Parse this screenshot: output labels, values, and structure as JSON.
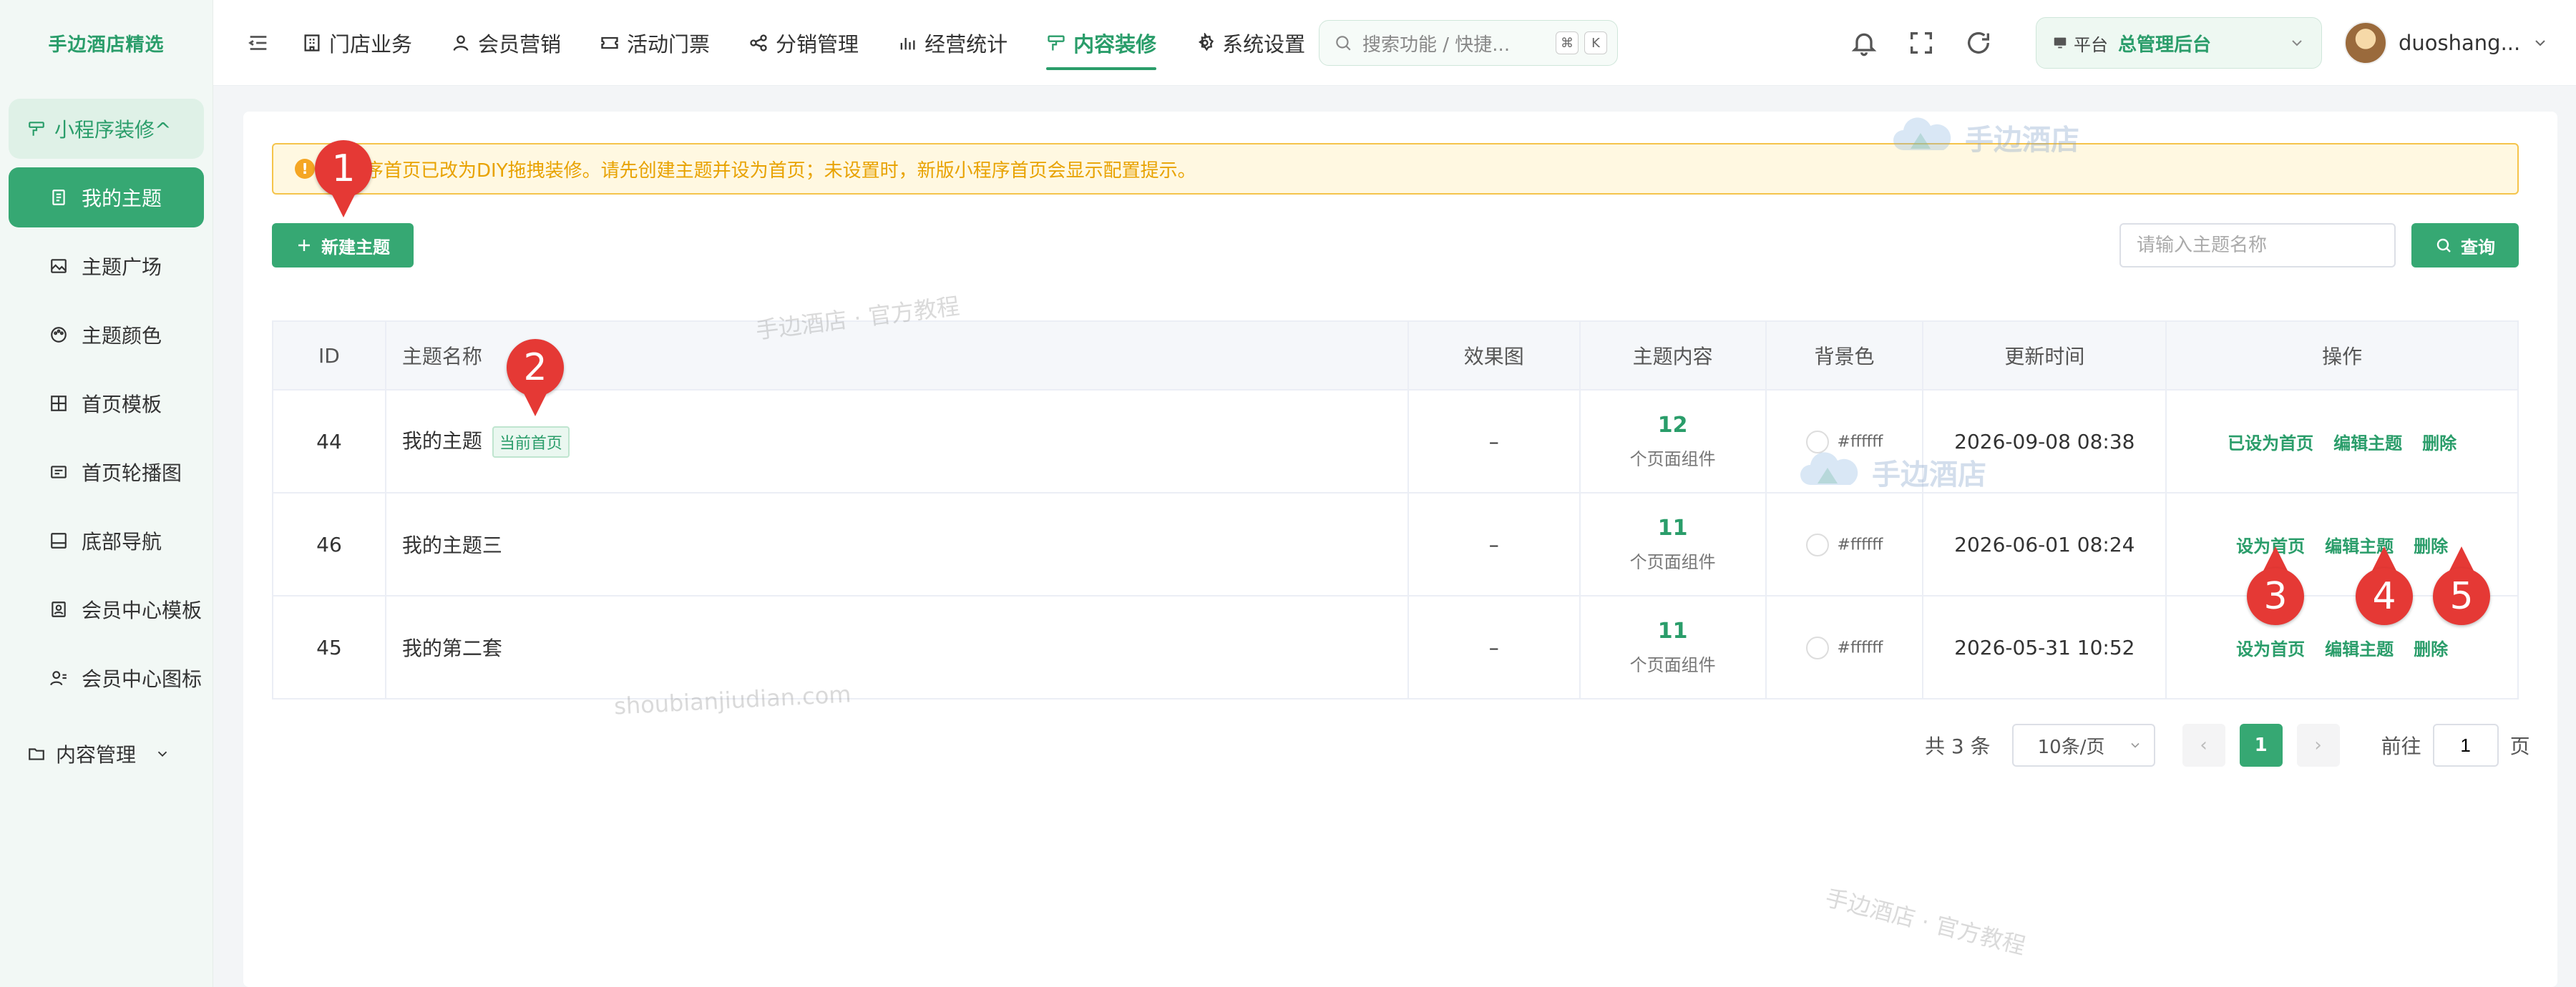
{
  "brand": "手边酒店精选",
  "sidebar": {
    "group_label": "小程序装修^",
    "items": [
      {
        "label": "我的主题",
        "icon": "document-icon",
        "active": true
      },
      {
        "label": "主题广场",
        "icon": "gallery-icon"
      },
      {
        "label": "主题颜色",
        "icon": "palette-icon"
      },
      {
        "label": "首页模板",
        "icon": "grid-icon"
      },
      {
        "label": "首页轮播图",
        "icon": "carousel-icon"
      },
      {
        "label": "底部导航",
        "icon": "bottom-nav-icon"
      },
      {
        "label": "会员中心模板",
        "icon": "member-template-icon"
      },
      {
        "label": "会员中心图标",
        "icon": "member-icon-icon"
      }
    ],
    "collapse_group": "内容管理"
  },
  "topbar": {
    "nav": [
      {
        "label": "门店业务",
        "icon": "store-icon"
      },
      {
        "label": "会员营销",
        "icon": "user-icon"
      },
      {
        "label": "活动门票",
        "icon": "ticket-icon"
      },
      {
        "label": "分销管理",
        "icon": "share-icon"
      },
      {
        "label": "经营统计",
        "icon": "bar-chart-icon"
      },
      {
        "label": "内容装修",
        "icon": "brush-icon",
        "active": true
      },
      {
        "label": "系统设置",
        "icon": "gear-icon"
      }
    ],
    "search_placeholder": "搜索功能 / 快捷...",
    "search_keys": [
      "⌘",
      "K"
    ],
    "platform_tag": "平台",
    "platform_name": "总管理后台",
    "username": "duoshang..."
  },
  "notice": "小程序首页已改为DIY拖拽装修。请先创建主题并设为首页；未设置时，新版小程序首页会显示配置提示。",
  "actions": {
    "new_theme": "新建主题",
    "search_placeholder": "请输入主题名称",
    "query": "查询"
  },
  "table": {
    "headers": [
      "ID",
      "主题名称",
      "效果图",
      "主题内容",
      "背景色",
      "更新时间",
      "操作"
    ],
    "rows": [
      {
        "id": "44",
        "name": "我的主题",
        "tag": "当前首页",
        "preview": "–",
        "count": "12",
        "unit": "个页面组件",
        "bg": "#ffffff",
        "updated": "2026-09-08 08:38",
        "ops": [
          "已设为首页",
          "编辑主题",
          "删除"
        ]
      },
      {
        "id": "46",
        "name": "我的主题三",
        "tag": "",
        "preview": "–",
        "count": "11",
        "unit": "个页面组件",
        "bg": "#ffffff",
        "updated": "2026-06-01 08:24",
        "ops": [
          "设为首页",
          "编辑主题",
          "删除"
        ]
      },
      {
        "id": "45",
        "name": "我的第二套",
        "tag": "",
        "preview": "–",
        "count": "11",
        "unit": "个页面组件",
        "bg": "#ffffff",
        "updated": "2026-05-31 10:52",
        "ops": [
          "设为首页",
          "编辑主题",
          "删除"
        ]
      }
    ]
  },
  "pagination": {
    "total": "共 3 条",
    "page_size": "10条/页",
    "current_page": "1",
    "goto_label": "前往",
    "goto_value": "1",
    "page_suffix": "页"
  },
  "watermarks": {
    "logo_text": "手边酒店",
    "tutorial": "手边酒店 · 官方教程",
    "domain": "shoubianjiudian.com"
  },
  "markers": [
    "1",
    "2",
    "3",
    "4",
    "5"
  ]
}
